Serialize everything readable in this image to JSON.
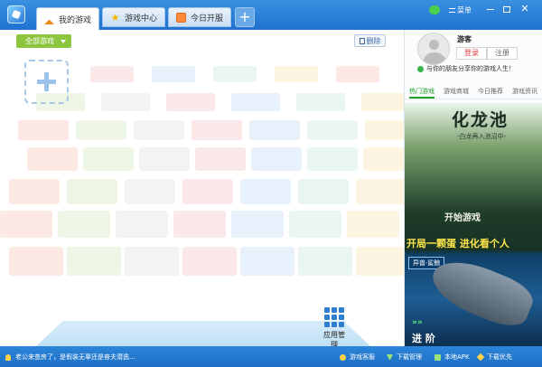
{
  "titlebar": {
    "tabs": [
      {
        "label": "我的游戏",
        "icon": "home-icon",
        "active": true
      },
      {
        "label": "游戏中心",
        "icon": "star-icon",
        "active": false
      },
      {
        "label": "今日开服",
        "icon": "calendar-icon",
        "active": false
      }
    ],
    "add_tab": "+",
    "menu_label": "菜单",
    "star_glyph": "★"
  },
  "main": {
    "all_games_label": "全部游戏",
    "delete_label": "删除",
    "app_manage_label": "应用管理"
  },
  "sidebar": {
    "username": "游客",
    "login_label": "登录",
    "register_label": "注册",
    "share_text": "与你的朋友分享你的游戏人生！",
    "tabs": [
      "热门游戏",
      "游戏商城",
      "今日推荐",
      "游戏资讯"
    ],
    "ad1": {
      "title": "化龙池",
      "subtitle": "-白龙再入池沼中-",
      "cta": "开始游戏"
    },
    "ad2": {
      "title": "开局一颗蛋 进化看个人",
      "badge": "异兽·鲨鲸",
      "cta": "进 阶",
      "arrows": "»»"
    }
  },
  "statusbar": {
    "news": "老公来查房了，是假装无辜还是奋夫潜逃...",
    "links": [
      "游戏客服",
      "下载管理",
      "本地APK",
      "下载优先"
    ]
  },
  "colors": {
    "titlebar": "#2a81da",
    "accent_green": "#8cc63f",
    "hot_tab": "#27a02a",
    "login_red": "#e13a3a"
  }
}
